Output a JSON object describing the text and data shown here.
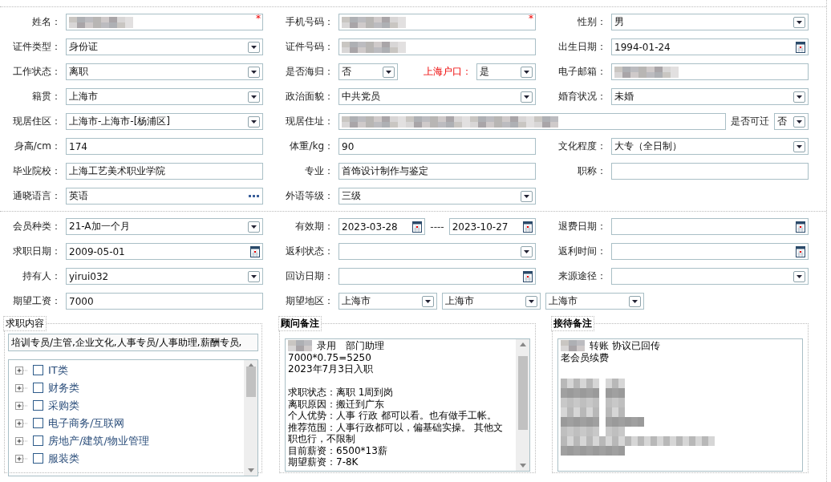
{
  "basic_info": {
    "rows": [
      {
        "cells": [
          {
            "label": "姓名：",
            "controls": [
              {
                "kind": "blurred",
                "required_mark": "*"
              }
            ]
          },
          {
            "label": "手机号码：",
            "controls": [
              {
                "kind": "blurred",
                "required_mark": "*"
              }
            ]
          },
          {
            "label": "性别：",
            "controls": [
              {
                "kind": "select",
                "value": "男"
              }
            ]
          }
        ]
      },
      {
        "cells": [
          {
            "label": "证件类型：",
            "controls": [
              {
                "kind": "select",
                "value": "身份证"
              }
            ]
          },
          {
            "label": "证件号码：",
            "controls": [
              {
                "kind": "blurred"
              }
            ]
          },
          {
            "label": "出生日期：",
            "controls": [
              {
                "kind": "date",
                "value": "1994-01-24"
              }
            ]
          }
        ]
      },
      {
        "cells": [
          {
            "label": "工作状态：",
            "controls": [
              {
                "kind": "select",
                "value": "离职"
              }
            ]
          },
          {
            "label": "是否海归：",
            "controls": [
              {
                "kind": "select",
                "value": "否"
              },
              {
                "kind": "label",
                "text": "上海户口：",
                "highlight": true
              },
              {
                "kind": "select",
                "value": "是"
              }
            ]
          },
          {
            "label": "电子邮箱：",
            "controls": [
              {
                "kind": "blurred"
              }
            ]
          }
        ]
      },
      {
        "cells": [
          {
            "label": "籍贯：",
            "controls": [
              {
                "kind": "select",
                "value": "上海市"
              }
            ]
          },
          {
            "label": "政治面貌：",
            "controls": [
              {
                "kind": "select",
                "value": "中共党员"
              }
            ]
          },
          {
            "label": "婚育状况：",
            "controls": [
              {
                "kind": "select",
                "value": "未婚"
              }
            ]
          }
        ]
      },
      {
        "cells": [
          {
            "label": "现居住区：",
            "controls": [
              {
                "kind": "select",
                "value": "上海市-上海市-[杨浦区]"
              }
            ]
          },
          {
            "label": "现居住址：",
            "controls": [
              {
                "kind": "blurred"
              },
              {
                "kind": "label",
                "text": "是否可迁",
                "highlight": false
              },
              {
                "kind": "select",
                "value": "否"
              }
            ]
          }
        ]
      },
      {
        "cells": [
          {
            "label": "身高/cm：",
            "controls": [
              {
                "kind": "text",
                "value": "174"
              }
            ]
          },
          {
            "label": "体重/kg：",
            "controls": [
              {
                "kind": "text",
                "value": "90"
              }
            ]
          },
          {
            "label": "文化程度：",
            "controls": [
              {
                "kind": "select",
                "value": "大专（全日制）"
              }
            ]
          }
        ]
      },
      {
        "cells": [
          {
            "label": "毕业院校：",
            "controls": [
              {
                "kind": "text",
                "value": "上海工艺美术职业学院"
              }
            ]
          },
          {
            "label": "专业：",
            "controls": [
              {
                "kind": "text",
                "value": "首饰设计制作与鉴定"
              }
            ]
          },
          {
            "label": "职称：",
            "controls": [
              {
                "kind": "text"
              }
            ]
          }
        ]
      },
      {
        "cells": [
          {
            "label": "通晓语言：",
            "controls": [
              {
                "kind": "picker",
                "value": "英语"
              }
            ]
          },
          {
            "label": "外语等级：",
            "controls": [
              {
                "kind": "select",
                "value": "三级"
              }
            ]
          }
        ]
      }
    ]
  },
  "membership": {
    "rows": [
      {
        "cells": [
          {
            "label": "会员种类：",
            "controls": [
              {
                "kind": "select",
                "value": "21-A加一个月"
              }
            ]
          },
          {
            "label": "有效期：",
            "controls": [
              {
                "kind": "date",
                "value": "2023-03-28"
              },
              {
                "kind": "dash",
                "text": "----"
              },
              {
                "kind": "date",
                "value": "2023-10-27"
              }
            ]
          },
          {
            "label": "退费日期：",
            "controls": [
              {
                "kind": "date"
              }
            ]
          }
        ]
      },
      {
        "cells": [
          {
            "label": "求职日期：",
            "controls": [
              {
                "kind": "date",
                "value": "2009-05-01"
              }
            ]
          },
          {
            "label": "返利状态：",
            "controls": [
              {
                "kind": "select"
              }
            ]
          },
          {
            "label": "返利时间：",
            "controls": [
              {
                "kind": "date"
              }
            ]
          }
        ]
      },
      {
        "cells": [
          {
            "label": "持有人：",
            "controls": [
              {
                "kind": "select",
                "value": "yirui032"
              }
            ]
          },
          {
            "label": "回访日期：",
            "controls": [
              {
                "kind": "date"
              }
            ]
          },
          {
            "label": "来源途径：",
            "controls": [
              {
                "kind": "select"
              }
            ]
          }
        ]
      },
      {
        "cells": [
          {
            "label": "期望工资：",
            "controls": [
              {
                "kind": "text",
                "value": "7000"
              }
            ]
          },
          {
            "label": "期望地区：",
            "controls": [
              {
                "kind": "select",
                "value": "上海市"
              },
              {
                "kind": "select",
                "value": "上海市"
              },
              {
                "kind": "select",
                "value": "上海市"
              }
            ]
          }
        ]
      }
    ]
  },
  "panels": [
    {
      "kind": "tree",
      "title": "求职内容",
      "value": "培训专员/主管,企业文化,人事专员/人事助理,薪酬专员,",
      "items": [
        {
          "label": "IT类",
          "expanded": false,
          "checked": false
        },
        {
          "label": "财务类",
          "expanded": false,
          "checked": false
        },
        {
          "label": "采购类",
          "expanded": false,
          "checked": false
        },
        {
          "label": "电子商务/互联网",
          "expanded": false,
          "checked": false
        },
        {
          "label": "房地产/建筑/物业管理",
          "expanded": false,
          "checked": false
        },
        {
          "label": "服装类",
          "expanded": false,
          "checked": false
        }
      ]
    },
    {
      "kind": "notes",
      "title": "顾问备注",
      "scrollbar": true,
      "lines": [
        {
          "kind": "text",
          "text": "录用　部门助理",
          "redacted": true
        },
        {
          "kind": "text",
          "text": "7000*0.75=5250",
          "redacted": false
        },
        {
          "kind": "text",
          "text": "2023年7月3日入职",
          "redacted": false
        },
        {
          "kind": "gap"
        },
        {
          "kind": "text",
          "text": "求职状态：离职 1周到岗",
          "redacted": false
        },
        {
          "kind": "text",
          "text": "离职原因：搬迁到广东",
          "redacted": false
        },
        {
          "kind": "text",
          "text": "个人优势：人事 行政 都可以看。也有做手工帐。",
          "redacted": false
        },
        {
          "kind": "text",
          "text": "推荐范围：人事行政都可以，偏基础实操。 其他文",
          "redacted": false
        },
        {
          "kind": "text",
          "text": "职也行，不限制",
          "redacted": false
        },
        {
          "kind": "text",
          "text": "目前薪资：6500*13薪",
          "redacted": false
        },
        {
          "kind": "text",
          "text": "期望薪资：7-8K",
          "redacted": false
        }
      ]
    },
    {
      "kind": "notes",
      "title": "接待备注",
      "scrollbar": false,
      "lines": [
        {
          "kind": "text",
          "text": "转账 协议已回传",
          "redacted": true
        },
        {
          "kind": "text",
          "text": "老会员续费",
          "redacted": false
        },
        {
          "kind": "gap"
        },
        {
          "kind": "blurred"
        }
      ]
    }
  ]
}
